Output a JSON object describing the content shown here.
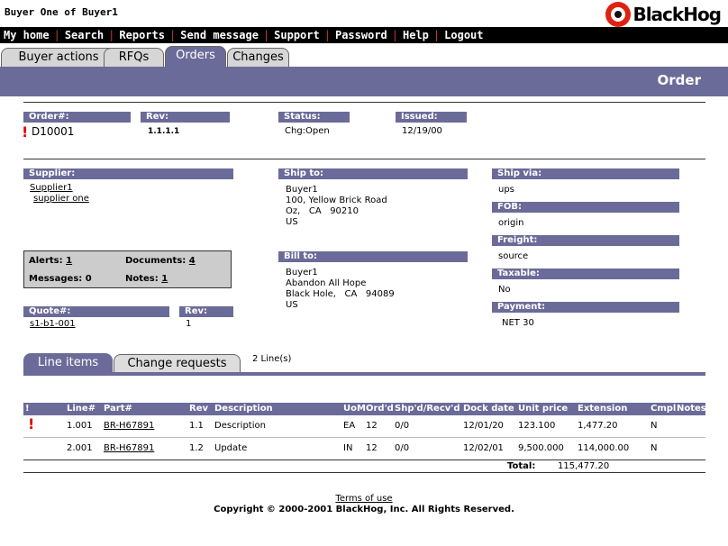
{
  "window_title": "Buyer One of Buyer1",
  "brand": {
    "name": "BlackHog",
    "accent": "#6b6b99",
    "alert_color": "#dd0000"
  },
  "nav": [
    "My home",
    "Search",
    "Reports",
    "Send message",
    "Support",
    "Password",
    "Help",
    "Logout"
  ],
  "tabs": [
    {
      "label": "Buyer actions",
      "active": false
    },
    {
      "label": "RFQs",
      "active": false
    },
    {
      "label": "Orders",
      "active": true
    },
    {
      "label": "Changes",
      "active": false
    }
  ],
  "page_heading": "Order",
  "order": {
    "order_label": "Order#:",
    "order_value": "D10001",
    "rev_label": "Rev:",
    "rev_value": "1.1.1.1",
    "status_label": "Status:",
    "status_value": "Chg:Open",
    "issued_label": "Issued:",
    "issued_value": "12/19/00"
  },
  "supplier": {
    "label": "Supplier:",
    "code": "Supplier1",
    "name": "supplier one"
  },
  "ship_to": {
    "label": "Ship to:",
    "lines": [
      "Buyer1",
      "100, Yellow Brick Road",
      "Oz,   CA   90210",
      "US"
    ]
  },
  "bill_to": {
    "label": "Bill to:",
    "lines": [
      "Buyer1",
      "Abandon All Hope",
      "Black Hole,   CA   94089",
      "US"
    ]
  },
  "ship_via": {
    "label": "Ship via:",
    "value": "ups"
  },
  "fob": {
    "label": "FOB:",
    "value": "origin"
  },
  "freight": {
    "label": "Freight:",
    "value": "source"
  },
  "taxable": {
    "label": "Taxable:",
    "value": "No"
  },
  "payment": {
    "label": "Payment:",
    "value": "NET 30"
  },
  "alerts_box": {
    "alerts_label": "Alerts:",
    "alerts_value": "1",
    "documents_label": "Documents:",
    "documents_value": "4",
    "messages_label": "Messages:",
    "messages_value": "0",
    "notes_label": "Notes:",
    "notes_value": "1"
  },
  "quote": {
    "label": "Quote#:",
    "value": "s1-b1-001",
    "rev_label": "Rev:",
    "rev_value": "1"
  },
  "line_tabs": {
    "line_items": "Line items",
    "change_requests": "Change requests",
    "count": "2 Line(s)"
  },
  "table": {
    "headers": [
      "!",
      "Line#",
      "Part#",
      "Rev",
      "Description",
      "UoM",
      "Ord'd",
      "Shp'd/Recv'd",
      "Dock date",
      "Unit price",
      "Extension",
      "Cmpl",
      "Notes"
    ],
    "rows": [
      {
        "alert": "!",
        "line": "1.001",
        "part": "BR-H67891",
        "rev": "1.1",
        "desc": "Description",
        "uom": "EA",
        "ordd": "12",
        "shpd": "0/0",
        "dock": "12/01/20",
        "price": "123.100",
        "ext": "1,477.20",
        "cmpl": "N",
        "notes": ""
      },
      {
        "alert": "",
        "line": "2.001",
        "part": "BR-H67891",
        "rev": "1.2",
        "desc": "Update",
        "uom": "IN",
        "ordd": "12",
        "shpd": "0/0",
        "dock": "12/02/01",
        "price": "9,500.000",
        "ext": "114,000.00",
        "cmpl": "N",
        "notes": ""
      }
    ],
    "total_label": "Total:",
    "total_value": "115,477.20"
  },
  "footer": {
    "terms": "Terms of use",
    "copyright": "Copyright © 2000-2001 BlackHog, Inc. All Rights Reserved."
  }
}
